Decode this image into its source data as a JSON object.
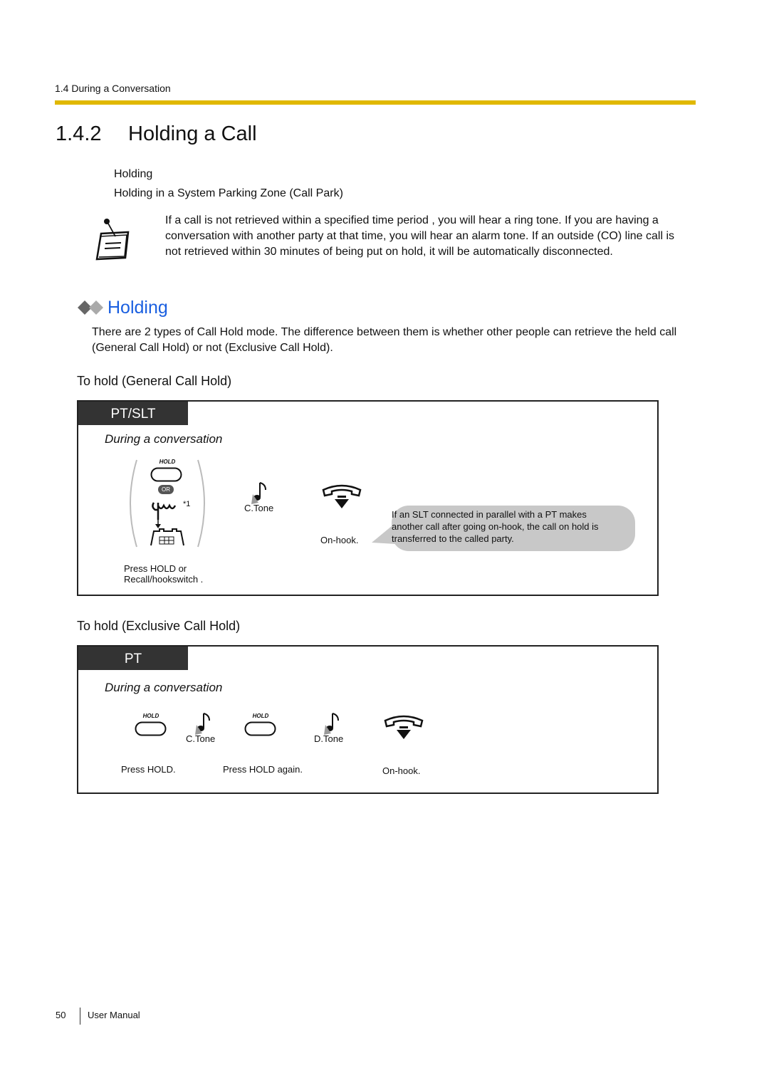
{
  "header": {
    "breadcrumb": "1.4 During a Conversation",
    "accent_color": "#e0b800"
  },
  "page_title": {
    "number": "1.4.2",
    "text": "Holding a Call"
  },
  "topic_links": [
    "Holding",
    "Holding in a System Parking Zone (Call Park)"
  ],
  "note": {
    "icon": "notepad-icon",
    "text": "If a call is not retrieved within a specified time period       , you will hear a ring tone. If you are having a conversation with another party at that time, you will hear an alarm tone. If an outside (CO) line call is not retrieved within 30 minutes of being put on hold, it will be automatically disconnected."
  },
  "section": {
    "title": "Holding",
    "title_color": "#1a5fe0",
    "icon": "double-diamond-icon",
    "intro": "There are 2 types of Call Hold mode. The difference between them is whether other people can retrieve the held call (General Call Hold) or not (Exclusive Call Hold)."
  },
  "general_hold": {
    "heading": "To hold (General Call Hold)",
    "tab": "PT/SLT",
    "condition": "During a conversation",
    "hold_key_label": "HOLD",
    "or_label": "OR",
    "footnote_marker": "*1",
    "step1_caption_line1": "Press HOLD or",
    "step1_caption_line2": "Recall/hookswitch   .",
    "tone_label": "C.Tone",
    "onhook_label": "On-hook.",
    "bubble_lines": [
      "If an SLT connected in parallel with a PT makes",
      "another call after going on-hook, the call on hold is",
      "transferred to the called party."
    ]
  },
  "exclusive_hold": {
    "heading": "To hold (Exclusive Call Hold)",
    "tab": "PT",
    "condition": "During a conversation",
    "hold_key_label": "HOLD",
    "step1_caption": "Press HOLD.",
    "tone1_label": "C.Tone",
    "step2_caption": "Press HOLD again.",
    "tone2_label": "D.Tone",
    "onhook_label": "On-hook."
  },
  "footer": {
    "page_number": "50",
    "doc_title": "User Manual"
  }
}
